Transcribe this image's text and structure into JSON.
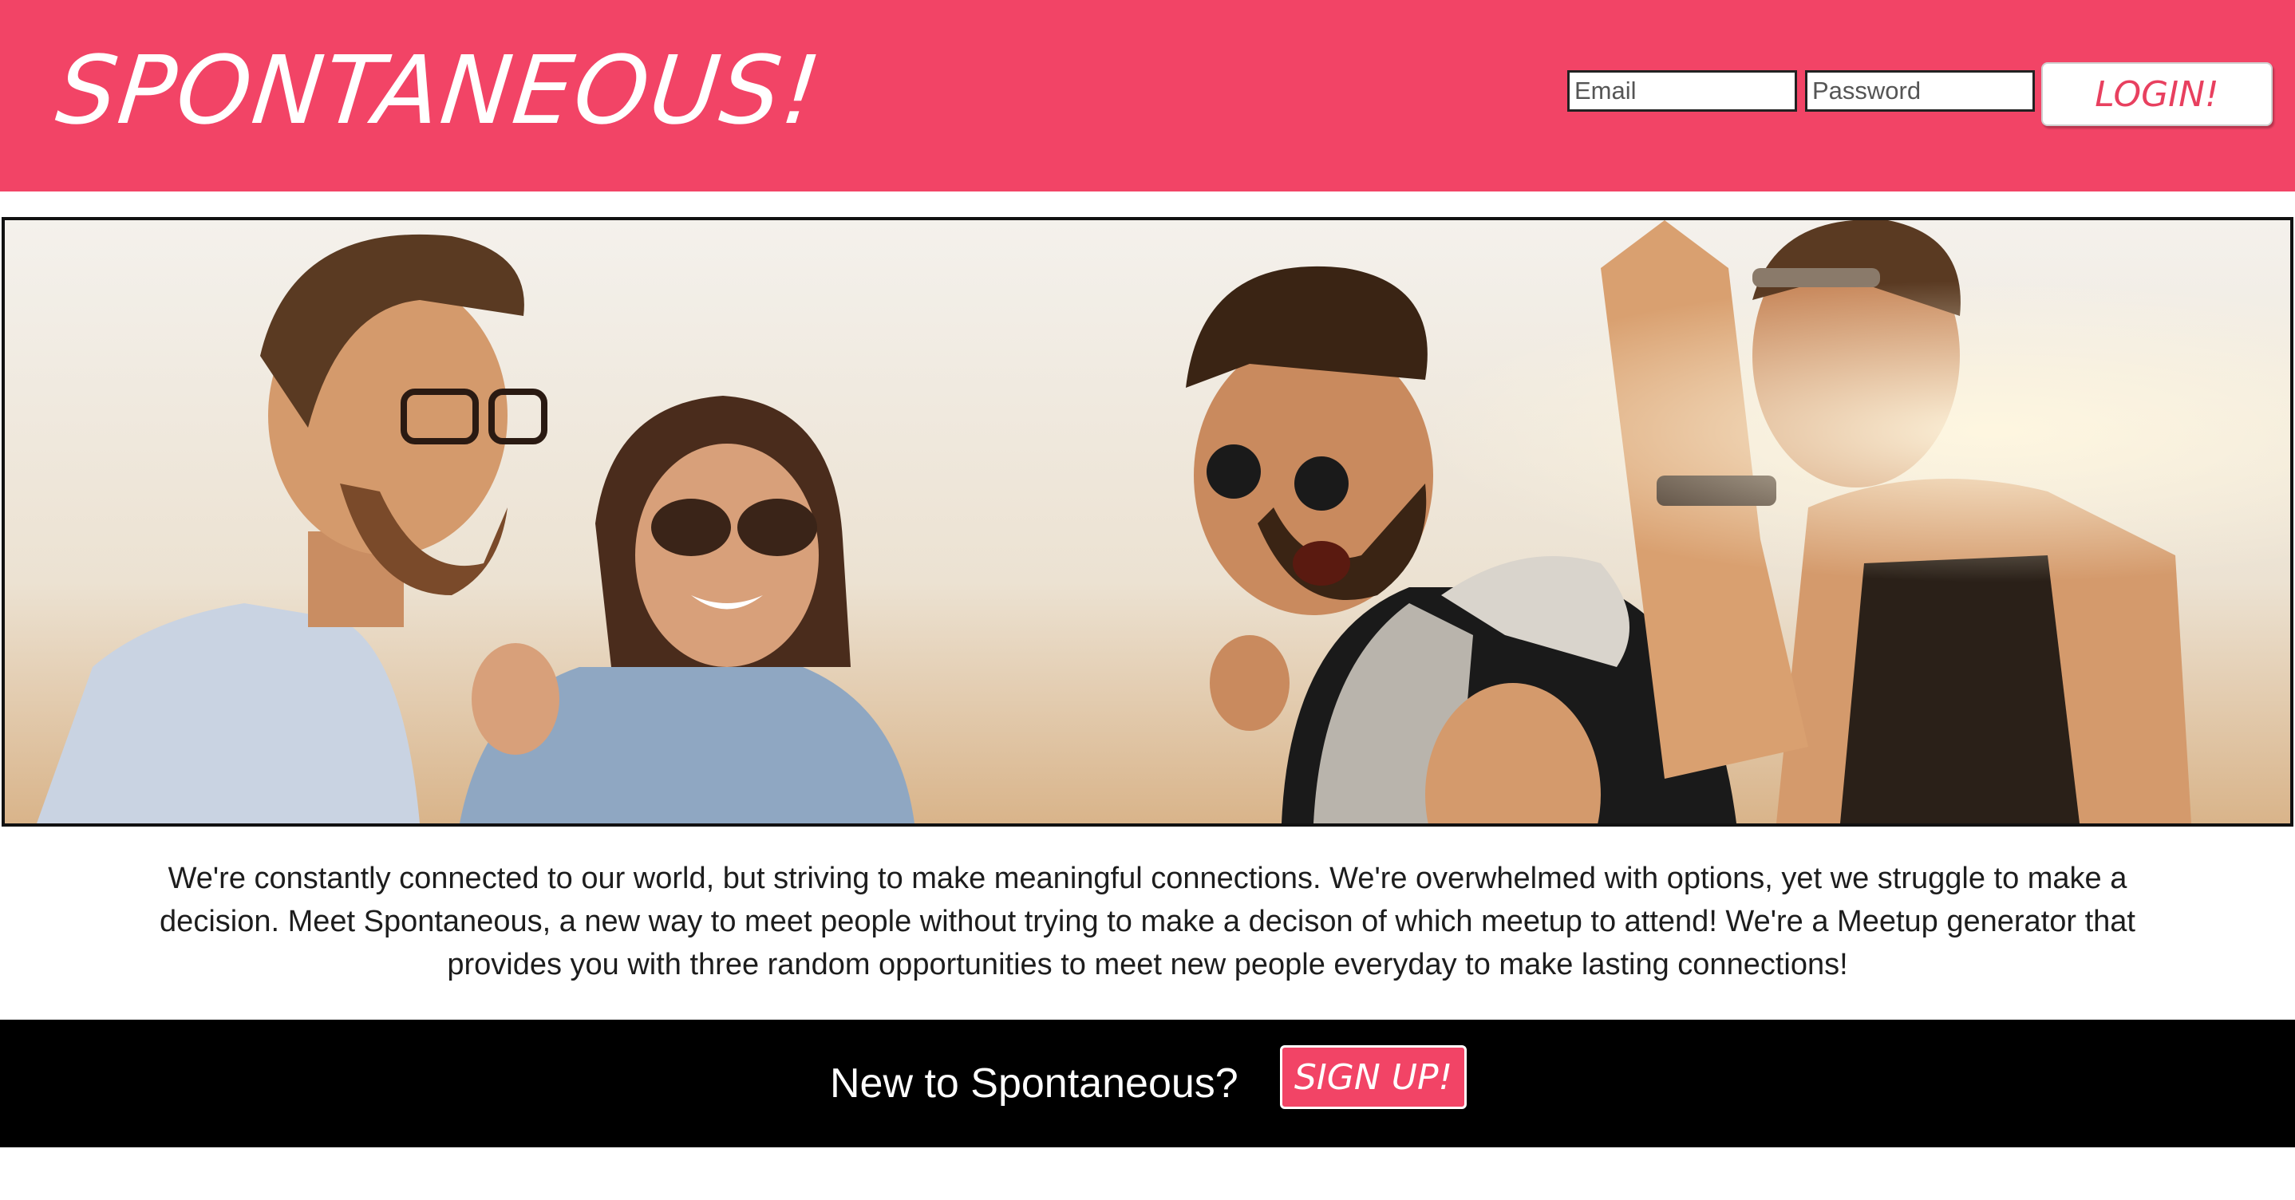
{
  "header": {
    "logo_text": "SPONTANEOUS!",
    "email_placeholder": "Email",
    "password_placeholder": "Password",
    "login_label": "LOGIN!"
  },
  "hero": {
    "image": "group-of-friends-laughing-photo"
  },
  "main": {
    "description": "We're constantly connected to our world, but striving to make meaningful connections. We're overwhelmed with options, yet we struggle to make a decision. Meet Spontaneous, a new way to meet people without trying to make a decison of which meetup to attend! We're a Meetup generator that provides you with three random opportunities to meet new people everyday to make lasting connections!"
  },
  "signup": {
    "prompt": "New to Spontaneous?",
    "button_label": "SIGN UP!"
  },
  "colors": {
    "brand_pink": "#f24466",
    "footer_bar": "#000000",
    "text_dark": "#1d1d1d"
  }
}
